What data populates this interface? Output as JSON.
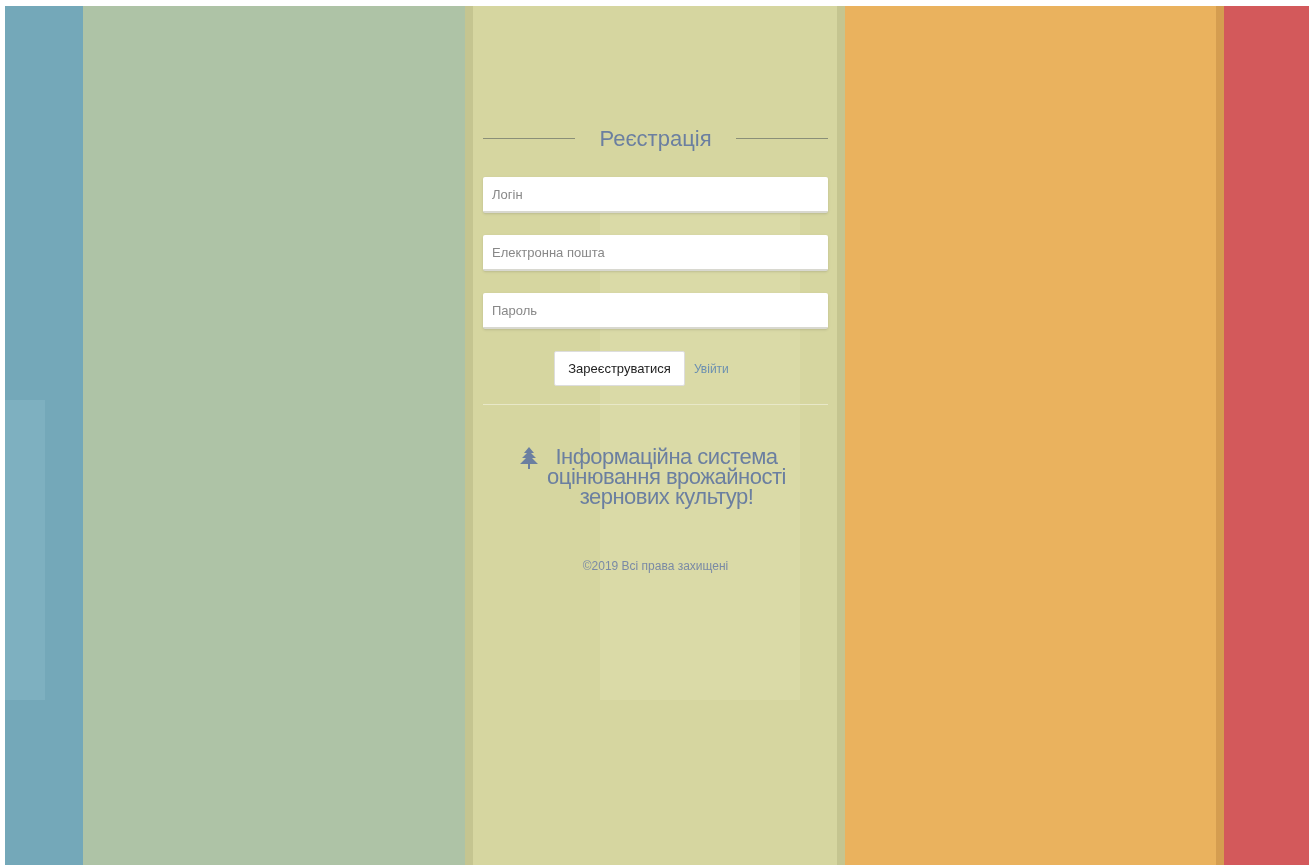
{
  "form": {
    "title": "Реєстрація",
    "fields": [
      {
        "placeholder": "Логін"
      },
      {
        "placeholder": "Електронна пошта"
      },
      {
        "placeholder": "Пароль"
      }
    ],
    "submit": "Зареєструватися",
    "link": "Увійти"
  },
  "headline": "Інформаційна система оцінювання врожайності зернових культур!",
  "footer": "©2019 Всі права захищені"
}
